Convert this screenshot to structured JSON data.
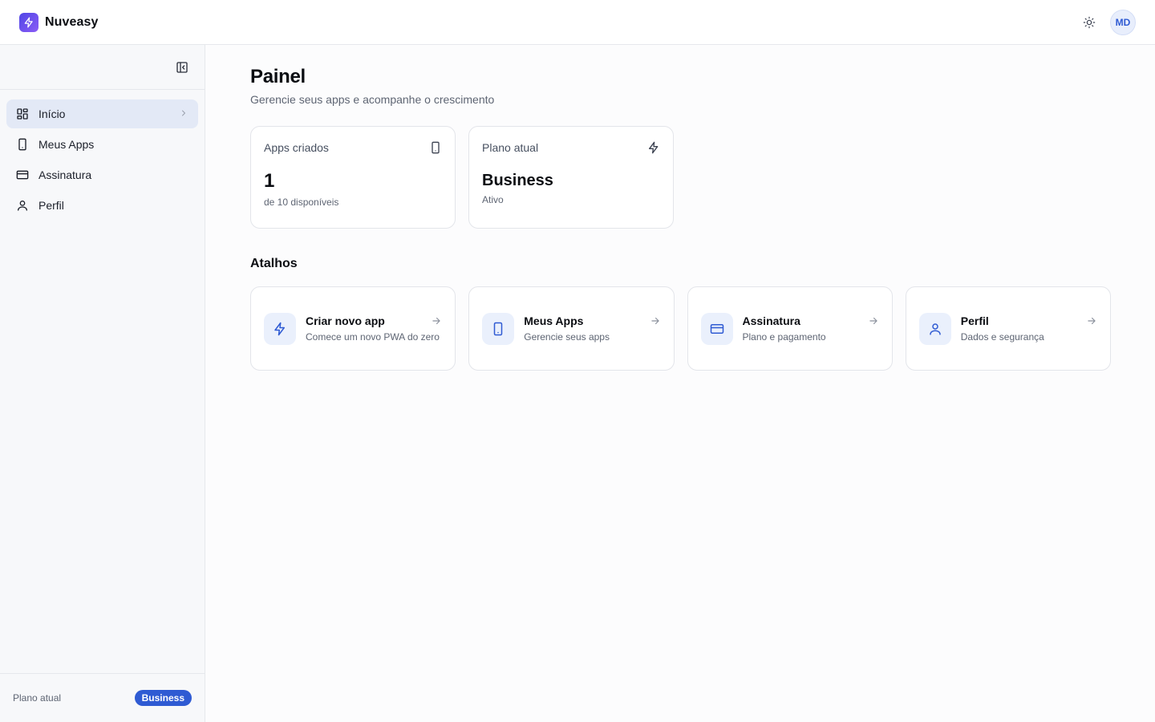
{
  "brand": {
    "name": "Nuveasy"
  },
  "header": {
    "avatar_initials": "MD",
    "theme_icon": "sun-icon"
  },
  "colors": {
    "accent": "#2f5bd3",
    "accent_soft": "#eaf0fc",
    "active_nav": "#e3e9f6",
    "logo_start": "#4f46e5",
    "logo_end": "#8b5cf6"
  },
  "sidebar": {
    "items": [
      {
        "label": "Início",
        "icon": "layout-grid-icon",
        "active": true
      },
      {
        "label": "Meus Apps",
        "icon": "smartphone-icon",
        "active": false
      },
      {
        "label": "Assinatura",
        "icon": "credit-card-icon",
        "active": false
      },
      {
        "label": "Perfil",
        "icon": "user-icon",
        "active": false
      }
    ],
    "footer": {
      "label": "Plano atual",
      "plan": "Business"
    }
  },
  "main": {
    "title": "Painel",
    "subtitle": "Gerencie seus apps e acompanhe o crescimento",
    "stats": [
      {
        "label": "Apps criados",
        "value": "1",
        "sub": "de 10 disponíveis",
        "icon": "smartphone-icon"
      },
      {
        "label": "Plano atual",
        "value": "Business",
        "sub": "Ativo",
        "icon": "zap-icon"
      }
    ],
    "shortcuts_title": "Atalhos",
    "shortcuts": [
      {
        "title": "Criar novo app",
        "sub": "Comece um novo PWA do zero",
        "icon": "zap-icon"
      },
      {
        "title": "Meus Apps",
        "sub": "Gerencie seus apps",
        "icon": "smartphone-icon"
      },
      {
        "title": "Assinatura",
        "sub": "Plano e pagamento",
        "icon": "credit-card-icon"
      },
      {
        "title": "Perfil",
        "sub": "Dados e segurança",
        "icon": "user-icon"
      }
    ]
  }
}
